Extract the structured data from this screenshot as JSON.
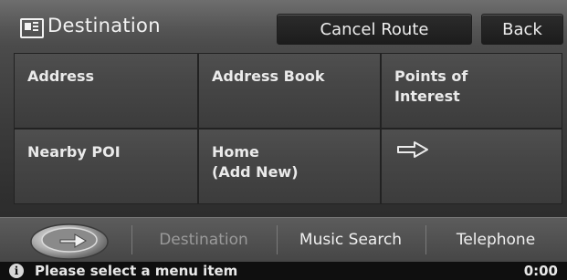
{
  "header": {
    "title": "Destination",
    "title_icon": "map-icon",
    "cancel_route_label": "Cancel Route",
    "back_label": "Back"
  },
  "menu": {
    "items": [
      {
        "label": "Address"
      },
      {
        "label": "Address Book"
      },
      {
        "label": "Points of\nInterest"
      },
      {
        "label": "Nearby POI"
      },
      {
        "label": "Home\n(Add New)"
      },
      {
        "label": "",
        "icon": "right-arrow-icon"
      }
    ]
  },
  "tabs": {
    "active": "Destination",
    "items": [
      {
        "label": "Destination"
      },
      {
        "label": "Music Search"
      },
      {
        "label": "Telephone"
      }
    ]
  },
  "status": {
    "icon": "info-icon",
    "message": "Please select a menu item",
    "clock": "0:00"
  }
}
